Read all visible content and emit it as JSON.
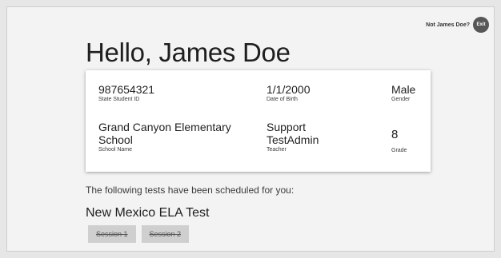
{
  "header": {
    "not_user_text": "Not James Doe?",
    "exit_label": "Exit"
  },
  "greeting": "Hello, James Doe",
  "student": {
    "id": {
      "value": "987654321",
      "label": "State Student ID"
    },
    "dob": {
      "value": "1/1/2000",
      "label": "Date of Birth"
    },
    "gender": {
      "value": "Male",
      "label": "Gender"
    },
    "school": {
      "value": "Grand Canyon Elementary School",
      "label": "School Name"
    },
    "teacher": {
      "value": "Support TestAdmin",
      "label": "Teacher"
    },
    "grade": {
      "value": "8",
      "label": "Grade"
    }
  },
  "scheduled_text": "The following tests have been scheduled for you:",
  "test": {
    "name": "New Mexico ELA Test",
    "sessions": [
      "Session 1",
      "Session 2"
    ]
  },
  "colors": {
    "exit_button": "#575757",
    "session_button": "#cfcfcf",
    "card_background": "#ffffff"
  }
}
